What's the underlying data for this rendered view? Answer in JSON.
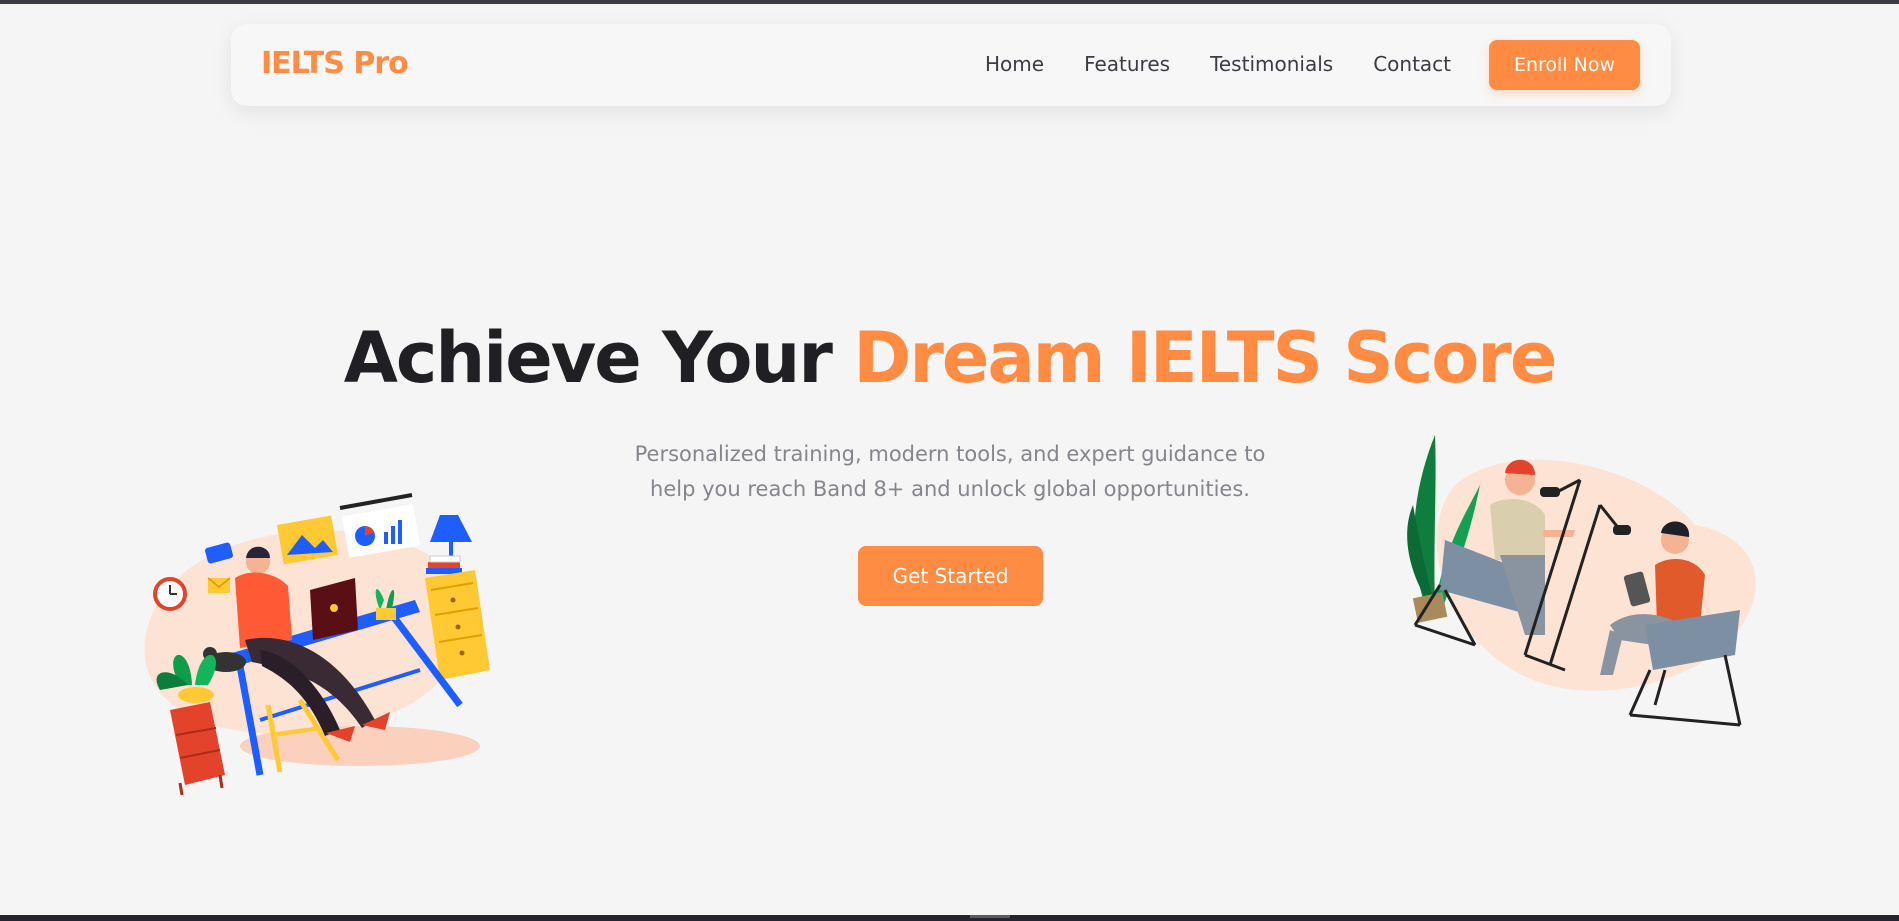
{
  "nav": {
    "logo": "IELTS Pro",
    "links": [
      {
        "label": "Home"
      },
      {
        "label": "Features"
      },
      {
        "label": "Testimonials"
      },
      {
        "label": "Contact"
      }
    ],
    "cta_label": "Enroll Now"
  },
  "hero": {
    "title_plain": "Achieve Your ",
    "title_accent": "Dream IELTS Score",
    "subtitle_line1": "Personalized training, modern tools, and expert guidance to",
    "subtitle_line2": "help you reach Band 8+ and unlock global opportunities.",
    "cta_label": "Get Started"
  },
  "colors": {
    "accent": "#ff8c42",
    "background": "#f5f5f5",
    "heading": "#1f1f24",
    "muted": "#85858d"
  },
  "illustrations": {
    "left": "person-working-at-desk-illustration",
    "right": "podcast-interview-illustration"
  }
}
